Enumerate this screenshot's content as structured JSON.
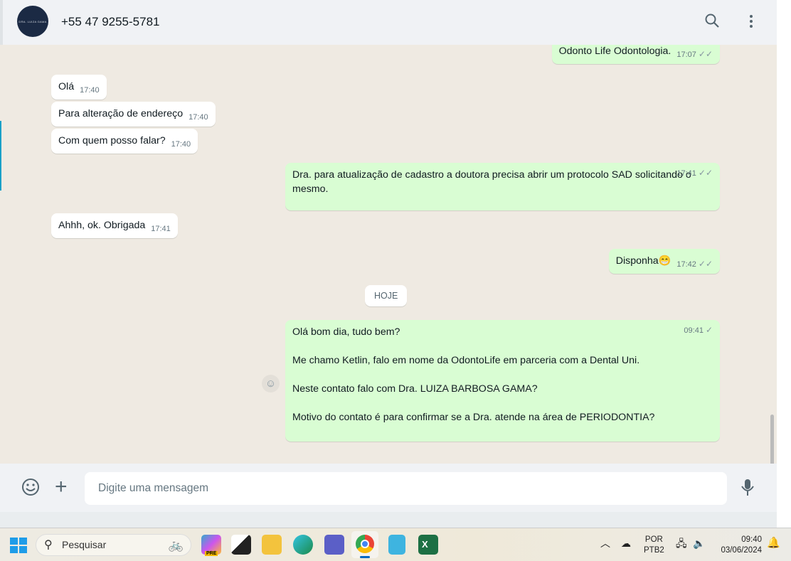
{
  "header": {
    "avatar_text": "DRA. LUIZA GAMA",
    "contact": "+55 47 9255-5781"
  },
  "messages": [
    {
      "dir": "out",
      "text": "Odonto Life Odontologia.",
      "time": "17:07"
    },
    {
      "dir": "in",
      "text": "Olá",
      "time": "17:40"
    },
    {
      "dir": "in",
      "text": "Para alteração de endereço",
      "time": "17:40"
    },
    {
      "dir": "in",
      "text": "Com quem posso falar?",
      "time": "17:40"
    },
    {
      "dir": "out",
      "text": "Dra. para atualização de cadastro a doutora precisa abrir um protocolo SAD solicitando o mesmo.",
      "time": "17:41"
    },
    {
      "dir": "in",
      "text": "Ahhh, ok. Obrigada",
      "time": "17:41"
    },
    {
      "dir": "out",
      "text": "Disponha😁",
      "time": "17:42"
    },
    {
      "dir": "out",
      "lines": [
        "Olá bom dia, tudo bem?",
        "Me chamo Ketlin, falo em nome da OdontoLife em parceria com a Dental Uni.",
        "Neste contato falo com Dra. LUIZA BARBOSA GAMA?",
        "Motivo do contato é para confirmar se a Dra. atende na área de PERIODONTIA?"
      ],
      "time": "09:41"
    }
  ],
  "day_divider": "HOJE",
  "composer": {
    "placeholder": "Digite uma mensagem"
  },
  "taskbar": {
    "search": "Pesquisar",
    "lang1": "POR",
    "lang2": "PTB2",
    "time": "09:40",
    "date": "03/06/2024",
    "copilot_badge": "PRE"
  },
  "colors": {
    "outgoing": "#d9fdd3",
    "incoming": "#ffffff",
    "chat_bg": "#efeae2"
  }
}
